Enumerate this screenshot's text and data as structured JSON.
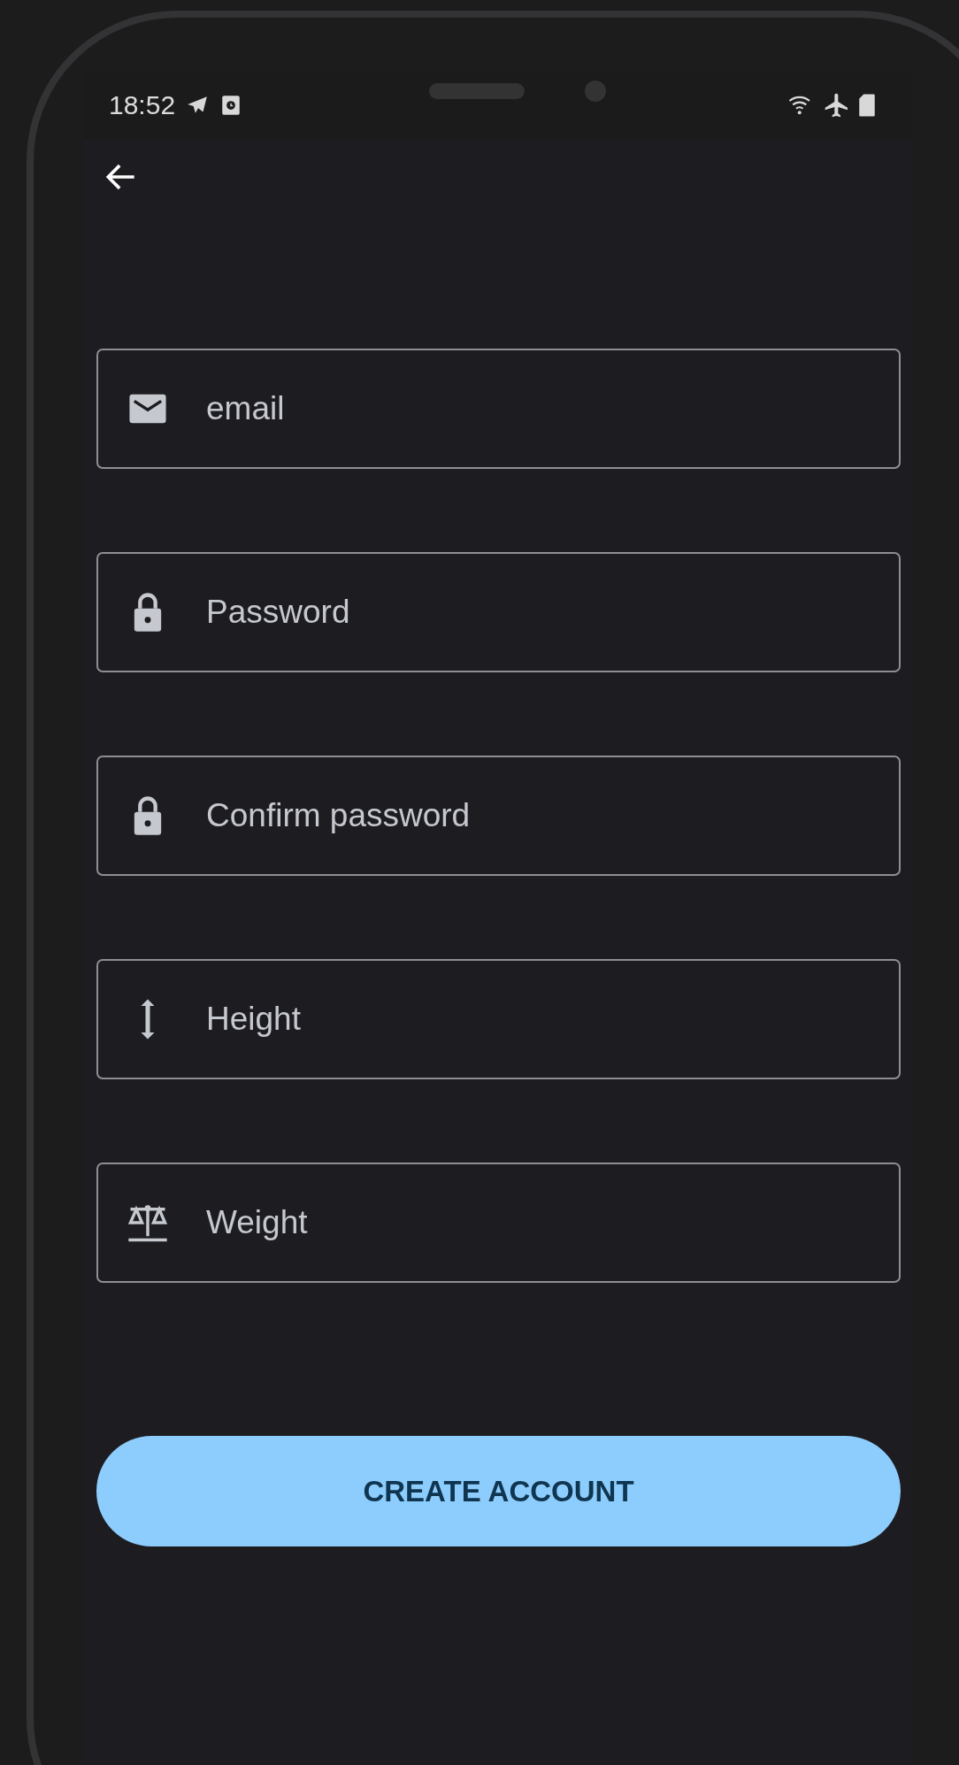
{
  "status_bar": {
    "time": "18:52"
  },
  "fields": [
    {
      "kind": "email",
      "placeholder": "email"
    },
    {
      "kind": "lock",
      "placeholder": "Password"
    },
    {
      "kind": "lock",
      "placeholder": "Confirm password"
    },
    {
      "kind": "height",
      "placeholder": "Height"
    },
    {
      "kind": "weight",
      "placeholder": "Weight"
    }
  ],
  "button": {
    "label": "CREATE ACCOUNT"
  }
}
